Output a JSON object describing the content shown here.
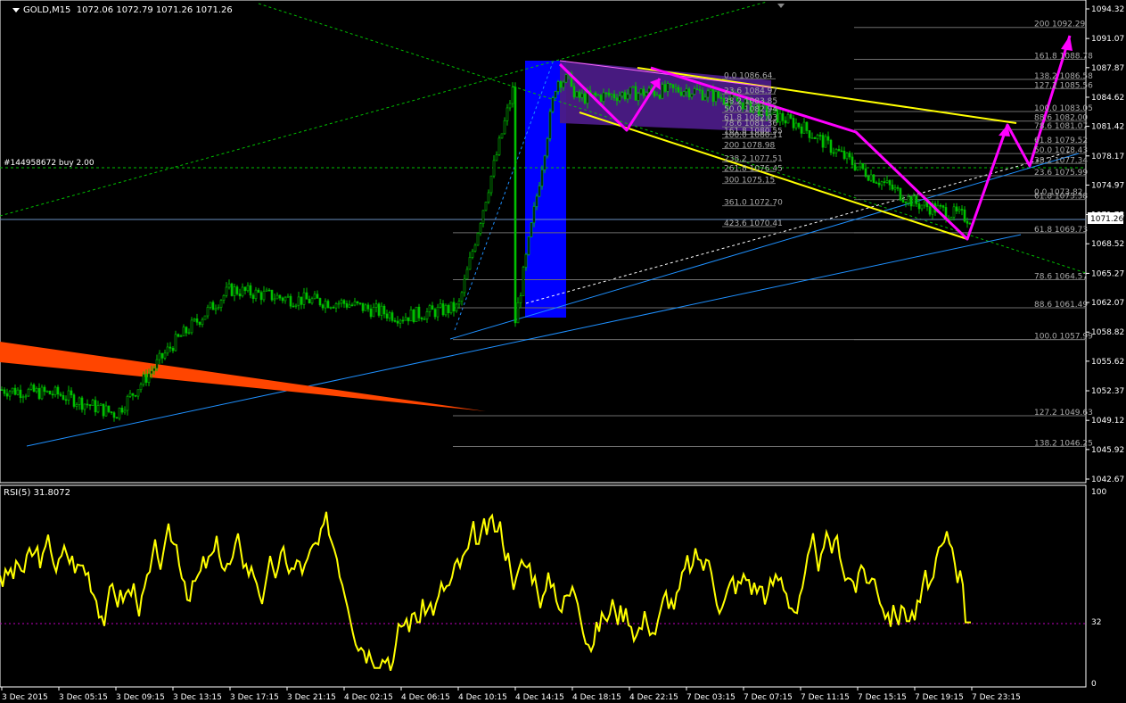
{
  "window": {
    "symbol_label": "GOLD,M15",
    "ohlc": "1072.06 1072.79 1071.26 1071.26",
    "current_price": "1071.26"
  },
  "order_label": "#144958672 buy 2.00",
  "rsi_label": "RSI(5) 31.8072",
  "price_axis": [
    "1094.32",
    "1091.07",
    "1087.87",
    "1084.62",
    "1081.42",
    "1078.17",
    "1074.97",
    "1071.73",
    "1068.52",
    "1065.27",
    "1062.07",
    "1058.82",
    "1055.62",
    "1052.37",
    "1049.12",
    "1045.92",
    "1042.67"
  ],
  "rsi_axis": [
    "100",
    "32",
    "0"
  ],
  "time_axis": [
    "3 Dec 2015",
    "3 Dec 05:15",
    "3 Dec 09:15",
    "3 Dec 13:15",
    "3 Dec 17:15",
    "3 Dec 21:15",
    "4 Dec 02:15",
    "4 Dec 06:15",
    "4 Dec 10:15",
    "4 Dec 14:15",
    "4 Dec 18:15",
    "4 Dec 22:15",
    "7 Dec 03:15",
    "7 Dec 07:15",
    "7 Dec 11:15",
    "7 Dec 15:15",
    "7 Dec 19:15",
    "7 Dec 23:15"
  ],
  "fib_upper": [
    "0.0 1086.64",
    "23.6 1084.97",
    "38.2 1083.85",
    "50.0 1082.94",
    "61.8 1082.03",
    "78.6 1081.36",
    "100.0 1080.11",
    "161.8 1080.55",
    "200 1078.98",
    "238.2 1077.51",
    "261.8 1076.45",
    "300 1075.15",
    "361.0 1072.70",
    "423.6 1070.41"
  ],
  "fib_right": [
    "200 1092.29",
    "161.8 1088.78",
    "138.2 1086.58",
    "127.2 1085.56",
    "100.0 1083.05",
    "88.6 1082.00",
    "78.6 1081.07",
    "61.8 1079.52",
    "50.0 1078.43",
    "38.2 1077.34",
    "23.6 1075.99",
    "0.0 1073.82",
    "61.8 1073.38",
    "61.8 1069.73",
    "78.6 1064.57",
    "88.6 1061.49",
    "100.0 1057.99",
    "127.2 1049.63",
    "138.2 1046.25"
  ],
  "colors": {
    "background": "#000000",
    "candle": "#00c000",
    "rsi": "#ffff00",
    "arrows": "#ff00ff",
    "channel_yellow": "#ffff00",
    "trend_blue": "#1e90ff",
    "box_blue": "#0000ff",
    "orange_band": "#ff4500",
    "purple_zone": "#5a1e8c"
  },
  "chart_data": {
    "type": "line",
    "title": "GOLD,M15",
    "price_range": [
      1042.67,
      1094.32
    ],
    "rsi_range": [
      0,
      100
    ],
    "rsi_level": 32,
    "close_path": [
      {
        "time": "3 Dec 2015",
        "price": 1052.5
      },
      {
        "time": "3 Dec 05:15",
        "price": 1052.0
      },
      {
        "time": "3 Dec 09:15",
        "price": 1049.8
      },
      {
        "time": "3 Dec 13:15",
        "price": 1057.5
      },
      {
        "time": "3 Dec 17:15",
        "price": 1063.5
      },
      {
        "time": "3 Dec 21:15",
        "price": 1062.5
      },
      {
        "time": "4 Dec 02:15",
        "price": 1062.0
      },
      {
        "time": "4 Dec 06:15",
        "price": 1060.5
      },
      {
        "time": "4 Dec 10:15",
        "price": 1061.5
      },
      {
        "time": "4 Dec 14:15",
        "price": 1086.5
      },
      {
        "time": "4 Dec 18:15",
        "price": 1084.5
      },
      {
        "time": "4 Dec 22:15",
        "price": 1085.0
      },
      {
        "time": "7 Dec 03:15",
        "price": 1085.5
      },
      {
        "time": "7 Dec 07:15",
        "price": 1084.0
      },
      {
        "time": "7 Dec 11:15",
        "price": 1081.5
      },
      {
        "time": "7 Dec 15:15",
        "price": 1077.0
      },
      {
        "time": "7 Dec 19:15",
        "price": 1073.0
      },
      {
        "time": "7 Dec 23:15",
        "price": 1071.26
      }
    ],
    "rsi_current": 31.8072
  }
}
